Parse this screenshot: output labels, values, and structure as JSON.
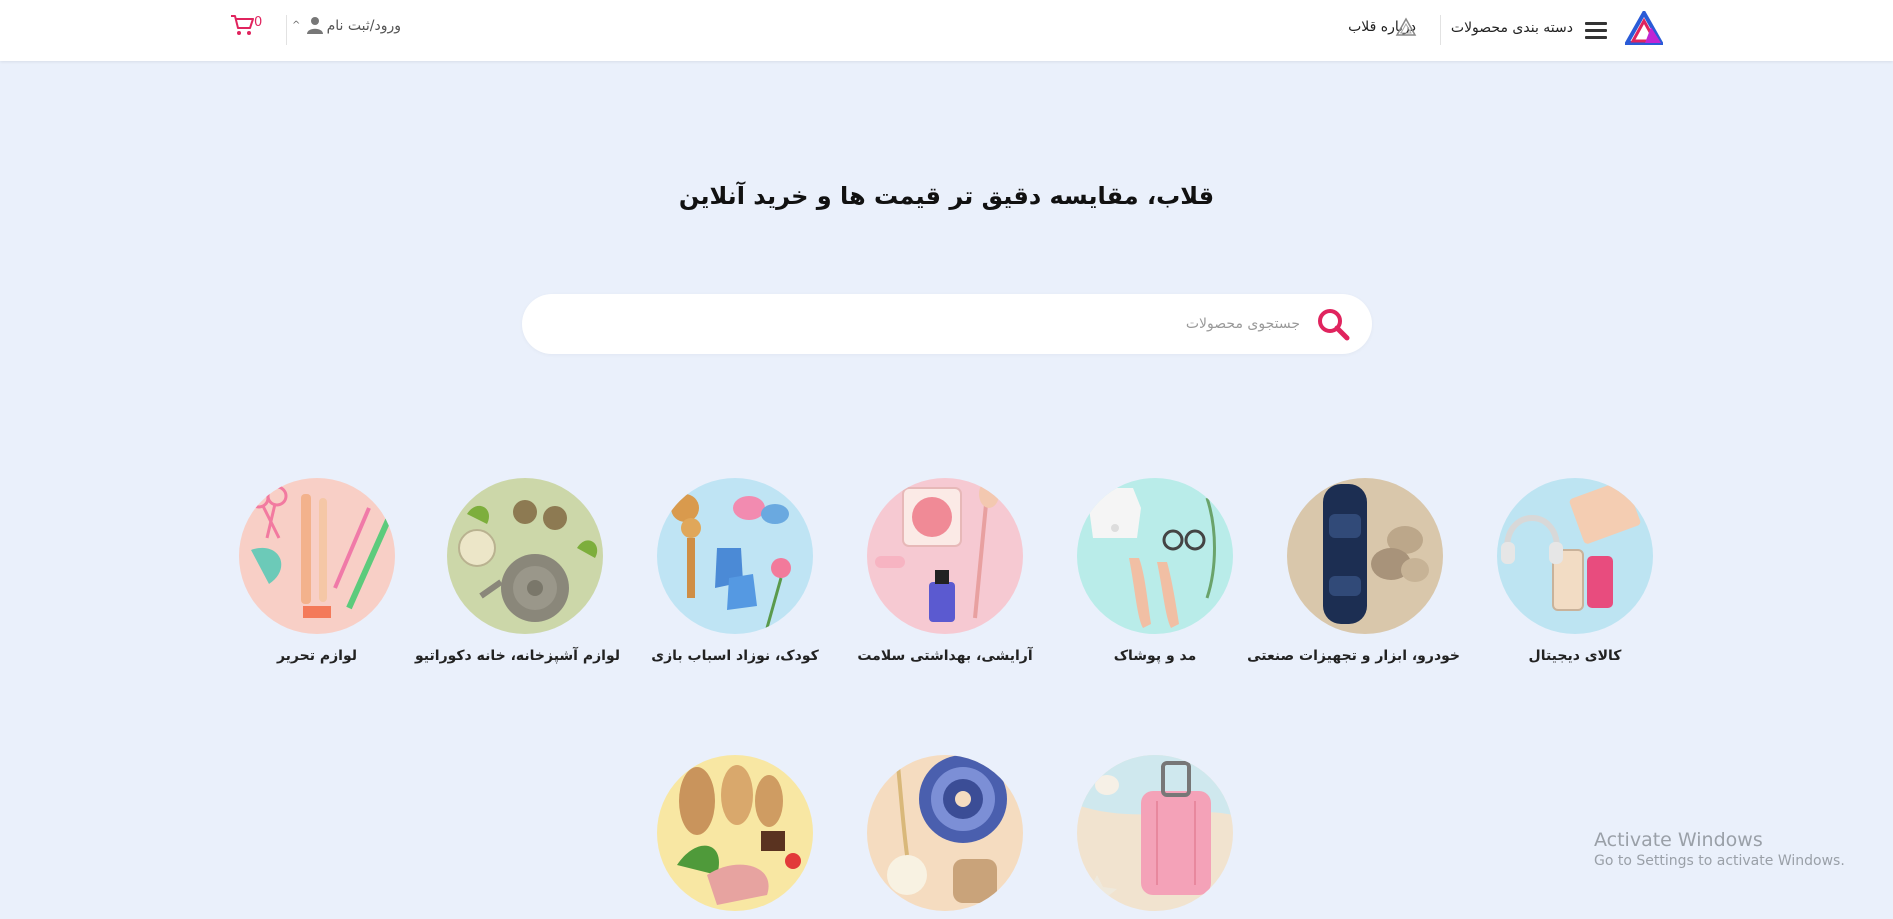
{
  "header": {
    "categories_label": "دسته بندی محصولات",
    "about_label": "درباره قلاب",
    "login_label": "ورود/ثبت نام",
    "cart_count": "0"
  },
  "hero": {
    "title": "قلاب، مقایسه دقیق تر قیمت ها و خرید آنلاین"
  },
  "search": {
    "placeholder": "جستجوی محصولات"
  },
  "categories": [
    {
      "label": "کالای دیجیتال",
      "icon": "laptop-phone-headphones-image",
      "color": "#bde4f2"
    },
    {
      "label": "خودرو، ابزار و تجهیزات صنعتی",
      "icon": "car-stones-image",
      "color": "#d9c7ab"
    },
    {
      "label": "مد و پوشاک",
      "icon": "clothing-shoes-image",
      "color": "#b9ece9"
    },
    {
      "label": "آرایشی، بهداشتی سلامت",
      "icon": "cosmetics-image",
      "color": "#f6c9d2"
    },
    {
      "label": "کودک، نوزاد اسباب بازی",
      "icon": "baby-toys-image",
      "color": "#bfe4f4"
    },
    {
      "label": "لوازم آشپزخانه، خانه دکوراتیو",
      "icon": "teapot-image",
      "color": "#ccd7a9"
    },
    {
      "label": "لوازم تحریر",
      "icon": "stationery-image",
      "color": "#f8cfc6"
    },
    {
      "label": "",
      "icon": "suitcase-beach-image",
      "color": "#f1e3cf"
    },
    {
      "label": "",
      "icon": "mandala-wheat-image",
      "color": "#f5dcc0"
    },
    {
      "label": "",
      "icon": "bread-food-image",
      "color": "#f8e7a3"
    }
  ],
  "watermark": {
    "line1": "Activate Windows",
    "line2": "Go to Settings to activate Windows."
  },
  "colors": {
    "background": "#eaf0fb",
    "accent": "#e0245e"
  }
}
